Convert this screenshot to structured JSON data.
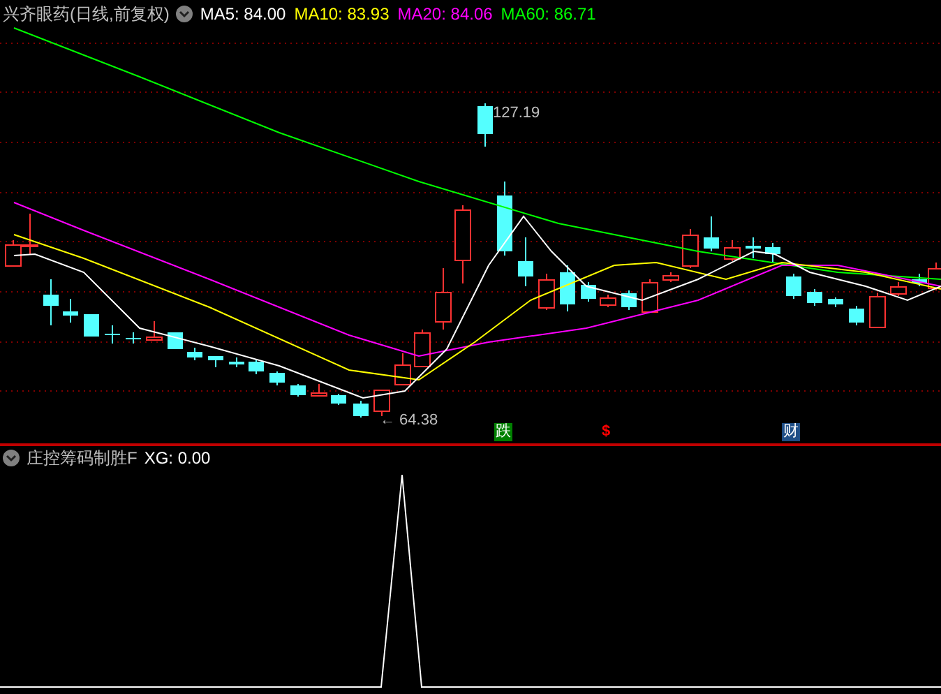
{
  "main_panel": {
    "title": "兴齐眼药(日线,前复权)",
    "indicators": [
      {
        "label": "MA5: 84.00",
        "color": "#ffffff"
      },
      {
        "label": "MA10: 83.93",
        "color": "#ffff00"
      },
      {
        "label": "MA20: 84.06",
        "color": "#ff00ff"
      },
      {
        "label": "MA60: 86.71",
        "color": "#00ff00"
      }
    ],
    "high_label": "127.19",
    "low_label": "← 64.38",
    "markers": [
      {
        "text": "跌",
        "kind": "box-green"
      },
      {
        "text": "$",
        "kind": "plain-red"
      },
      {
        "text": "财",
        "kind": "box-blue"
      }
    ]
  },
  "sub_panel": {
    "title": "庄控筹码制胜F",
    "reading": "XG: 0.00"
  }
}
